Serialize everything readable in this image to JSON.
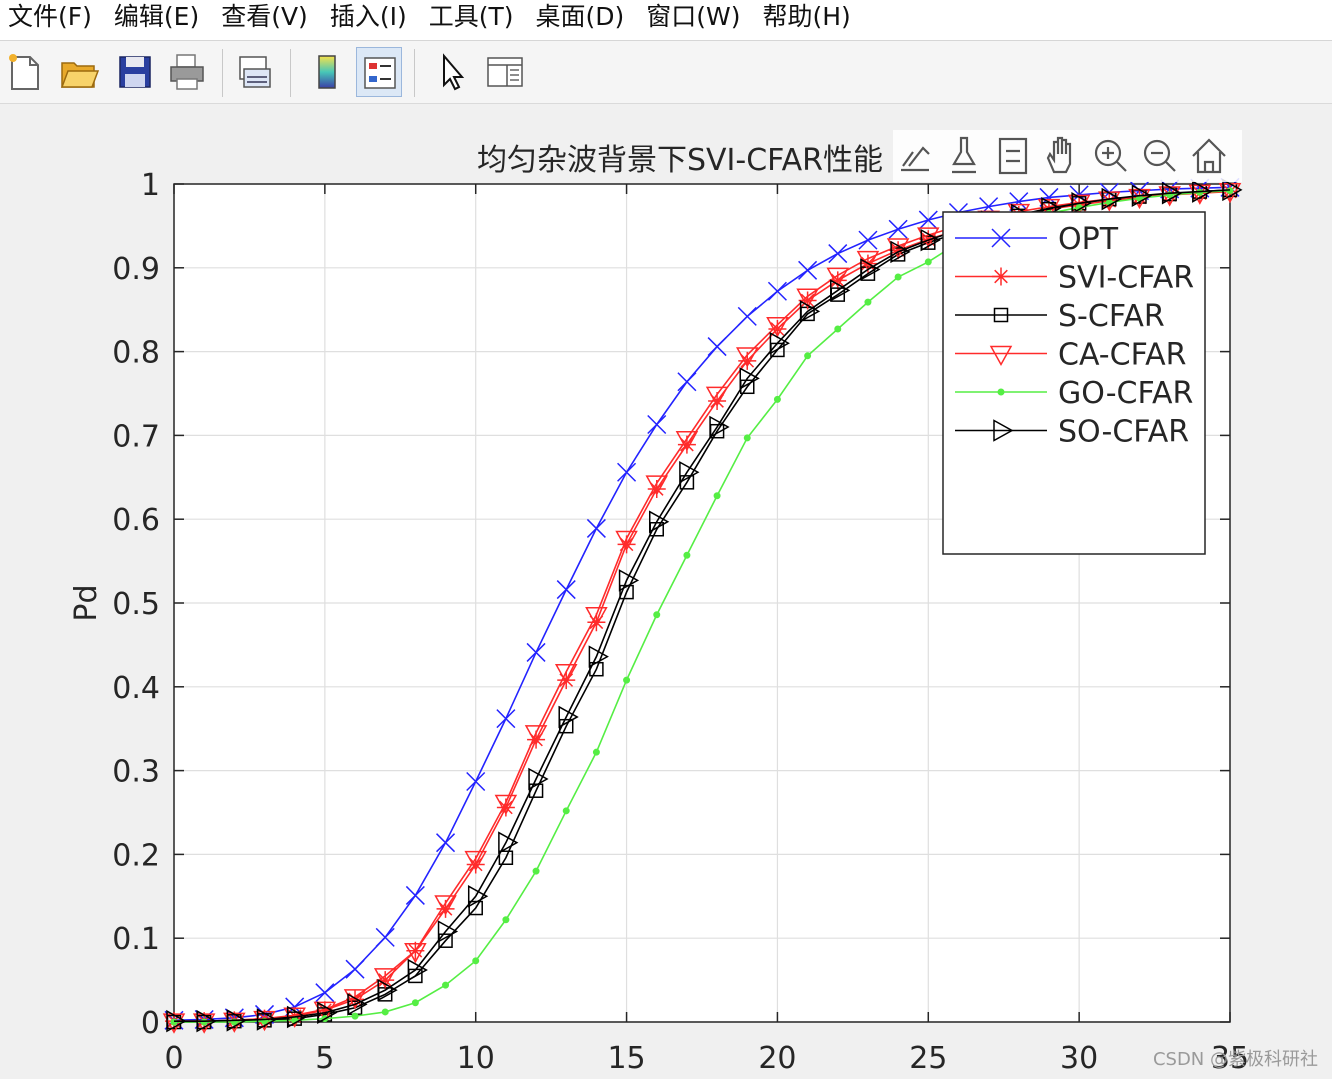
{
  "menu": {
    "items": [
      "文件(F)",
      "编辑(E)",
      "查看(V)",
      "插入(I)",
      "工具(T)",
      "桌面(D)",
      "窗口(W)",
      "帮助(H)"
    ]
  },
  "toolbar": {
    "buttons": [
      "new-figure-icon",
      "open-folder-icon",
      "save-icon",
      "print-icon",
      "link-plot-icon",
      "colorbar-icon",
      "legend-icon",
      "edit-plot-pointer-icon",
      "property-inspector-icon"
    ]
  },
  "axes_toolbar": {
    "buttons": [
      "export-icon",
      "brush-icon",
      "datatip-icon",
      "pan-hand-icon",
      "zoom-in-icon",
      "zoom-out-icon",
      "home-icon"
    ]
  },
  "watermark": "CSDN @紫极科研社",
  "chart_data": {
    "type": "line",
    "title": "均匀杂波背景下SVI-CFAR性能",
    "title_visible": "均匀杂波背景下SVI-CFAR性能",
    "xlabel": "",
    "ylabel": "Pd",
    "xlim": [
      0,
      35
    ],
    "ylim": [
      0,
      1
    ],
    "xticks": [
      0,
      5,
      10,
      15,
      20,
      25,
      30,
      35
    ],
    "yticks": [
      0,
      0.1,
      0.2,
      0.3,
      0.4,
      0.5,
      0.6,
      0.7,
      0.8,
      0.9,
      1
    ],
    "ytick_labels": [
      "0",
      "0.1",
      "0.2",
      "0.3",
      "0.4",
      "0.5",
      "0.6",
      "0.7",
      "0.8",
      "0.9",
      "1"
    ],
    "grid": true,
    "legend_position": "top-right",
    "x": [
      0,
      1,
      2,
      3,
      4,
      5,
      6,
      7,
      8,
      9,
      10,
      11,
      12,
      13,
      14,
      15,
      16,
      17,
      18,
      19,
      20,
      21,
      22,
      23,
      24,
      25,
      26,
      27,
      28,
      29,
      30,
      31,
      32,
      33,
      34,
      35
    ],
    "series": [
      {
        "name": "OPT",
        "color": "#2323ff",
        "marker": "x",
        "values": [
          0.002,
          0.003,
          0.005,
          0.009,
          0.018,
          0.035,
          0.063,
          0.101,
          0.151,
          0.214,
          0.287,
          0.362,
          0.441,
          0.516,
          0.589,
          0.656,
          0.713,
          0.764,
          0.806,
          0.842,
          0.872,
          0.897,
          0.917,
          0.933,
          0.946,
          0.957,
          0.966,
          0.973,
          0.979,
          0.984,
          0.987,
          0.99,
          0.992,
          0.994,
          0.995,
          0.996
        ]
      },
      {
        "name": "SVI-CFAR",
        "color": "#ff2b2b",
        "marker": "star",
        "values": [
          0.001,
          0.001,
          0.002,
          0.004,
          0.007,
          0.014,
          0.027,
          0.05,
          0.085,
          0.135,
          0.188,
          0.256,
          0.337,
          0.408,
          0.477,
          0.57,
          0.636,
          0.689,
          0.741,
          0.789,
          0.827,
          0.861,
          0.885,
          0.905,
          0.921,
          0.934,
          0.945,
          0.955,
          0.963,
          0.97,
          0.975,
          0.98,
          0.984,
          0.987,
          0.989,
          0.991
        ]
      },
      {
        "name": "S-CFAR",
        "color": "#000000",
        "marker": "square",
        "values": [
          0.0,
          0.0,
          0.001,
          0.002,
          0.004,
          0.009,
          0.017,
          0.033,
          0.055,
          0.097,
          0.136,
          0.196,
          0.276,
          0.353,
          0.421,
          0.513,
          0.588,
          0.644,
          0.705,
          0.758,
          0.802,
          0.845,
          0.868,
          0.893,
          0.916,
          0.93,
          0.942,
          0.953,
          0.962,
          0.97,
          0.977,
          0.982,
          0.985,
          0.988,
          0.991,
          0.993
        ]
      },
      {
        "name": "CA-CFAR",
        "color": "#ff2b2b",
        "marker": "triangle-down",
        "values": [
          0.001,
          0.001,
          0.002,
          0.004,
          0.008,
          0.015,
          0.03,
          0.055,
          0.085,
          0.142,
          0.195,
          0.262,
          0.345,
          0.418,
          0.486,
          0.577,
          0.643,
          0.696,
          0.749,
          0.796,
          0.832,
          0.866,
          0.891,
          0.911,
          0.926,
          0.939,
          0.95,
          0.959,
          0.967,
          0.973,
          0.978,
          0.982,
          0.985,
          0.988,
          0.99,
          0.992
        ]
      },
      {
        "name": "GO-CFAR",
        "color": "#55ee44",
        "marker": "dot",
        "values": [
          0.0,
          0.0,
          0.0,
          0.001,
          0.002,
          0.004,
          0.007,
          0.012,
          0.023,
          0.044,
          0.073,
          0.122,
          0.18,
          0.252,
          0.322,
          0.408,
          0.486,
          0.557,
          0.628,
          0.697,
          0.743,
          0.795,
          0.827,
          0.859,
          0.889,
          0.907,
          0.93,
          0.944,
          0.955,
          0.965,
          0.972,
          0.978,
          0.983,
          0.987,
          0.99,
          0.992
        ]
      },
      {
        "name": "SO-CFAR",
        "color": "#000000",
        "marker": "triangle-right",
        "values": [
          0.001,
          0.001,
          0.002,
          0.003,
          0.006,
          0.011,
          0.021,
          0.038,
          0.062,
          0.108,
          0.15,
          0.214,
          0.29,
          0.364,
          0.436,
          0.527,
          0.597,
          0.656,
          0.71,
          0.768,
          0.81,
          0.848,
          0.873,
          0.898,
          0.919,
          0.933,
          0.945,
          0.955,
          0.963,
          0.971,
          0.977,
          0.982,
          0.986,
          0.989,
          0.991,
          0.993
        ]
      }
    ]
  }
}
